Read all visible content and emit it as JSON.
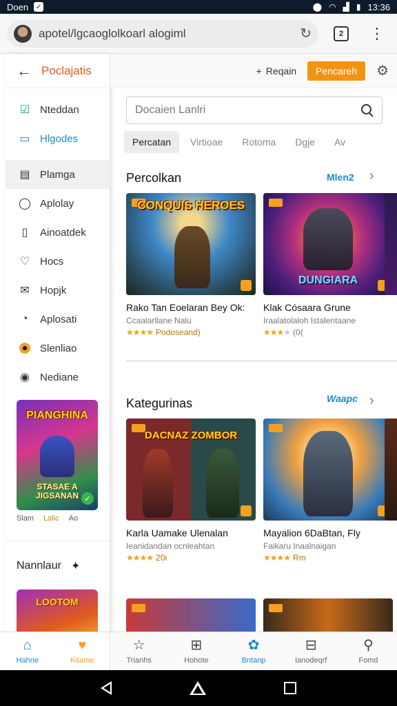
{
  "status_bar": {
    "carrier": "Doen",
    "time": "13:36"
  },
  "browser": {
    "url": "apotel/lgcaoglolkoarl alogiml"
  },
  "drawer": {
    "title": "Poclajatis",
    "items": [
      {
        "label": "Nteddan",
        "icon": "calendar-check-icon"
      },
      {
        "label": "Hlgodes",
        "icon": "folder-icon"
      },
      {
        "label": "Plamga",
        "icon": "briefcase-icon"
      },
      {
        "label": "Aplolay",
        "icon": "chat-bubble-icon"
      },
      {
        "label": "Ainoatdek",
        "icon": "document-icon"
      },
      {
        "label": "Hocs",
        "icon": "heart-bubble-icon"
      },
      {
        "label": "Hopjk",
        "icon": "inbox-icon"
      },
      {
        "label": "Aplosati",
        "icon": "clock-face-icon"
      },
      {
        "label": "Slenliao",
        "icon": "orange-dot-icon"
      },
      {
        "label": "Nediane",
        "icon": "info-circle-icon"
      }
    ],
    "promo": {
      "title": "PIANGHINA",
      "subtitle": "STASAE A JIGSANAN",
      "meta": [
        "Slam",
        "Lalic",
        "Ao"
      ]
    },
    "footer_title": "Nannlaur",
    "promo2_title": "LOOTOM"
  },
  "panel_header": {
    "link": "Reqain",
    "button": "Pencareh"
  },
  "search": {
    "placeholder": "Docaien Lanlri"
  },
  "filter_tabs": [
    "Percatan",
    "Virtioae",
    "Rotoma",
    "Dgje",
    "Av"
  ],
  "sections": [
    {
      "title": "Percolkan",
      "more": "Mlen2",
      "cards": [
        {
          "art": "CONQUIS HEROES",
          "name": "Rako Tan Eoelaran Bey Ok:",
          "sub": "Ccaalarllane Nalu",
          "stars": 4,
          "rating": "Podoseand)"
        },
        {
          "art": "DUNGIARA",
          "name": "Klak Cósaara Grune",
          "sub": "Iraalatolaloh Istalentaane",
          "stars": 3,
          "rating": "(0("
        }
      ]
    },
    {
      "title": "Kategurinas",
      "more": "Waapc",
      "cards": [
        {
          "art": "DACNAZ ZOMBOR",
          "name": "Karla Uamake Ulenalan",
          "sub": "Ieanidandan ocnleahtan",
          "stars": 4,
          "rating": "20i"
        },
        {
          "art": "",
          "name": "Mayalion 6DaBtan, Fly",
          "sub": "Faikaru Inaalnaigan",
          "stars": 4,
          "rating": "Rm"
        }
      ]
    }
  ],
  "bottom_nav": [
    {
      "label": "Hahne",
      "icon": "home-icon"
    },
    {
      "label": "Ksame",
      "icon": "heart-pin-icon"
    },
    {
      "label": "Trianhs",
      "icon": "star-outline-icon"
    },
    {
      "label": "Hohote",
      "icon": "plus-box-icon"
    },
    {
      "label": "Bntanp",
      "icon": "leaf-icon"
    },
    {
      "label": "Ianodeqrf",
      "icon": "minus-box-icon"
    },
    {
      "label": "Fomd",
      "icon": "person-icon"
    }
  ],
  "colors": {
    "accent_orange": "#f39313",
    "accent_blue": "#1e88c9",
    "title_red": "#e8571e"
  }
}
